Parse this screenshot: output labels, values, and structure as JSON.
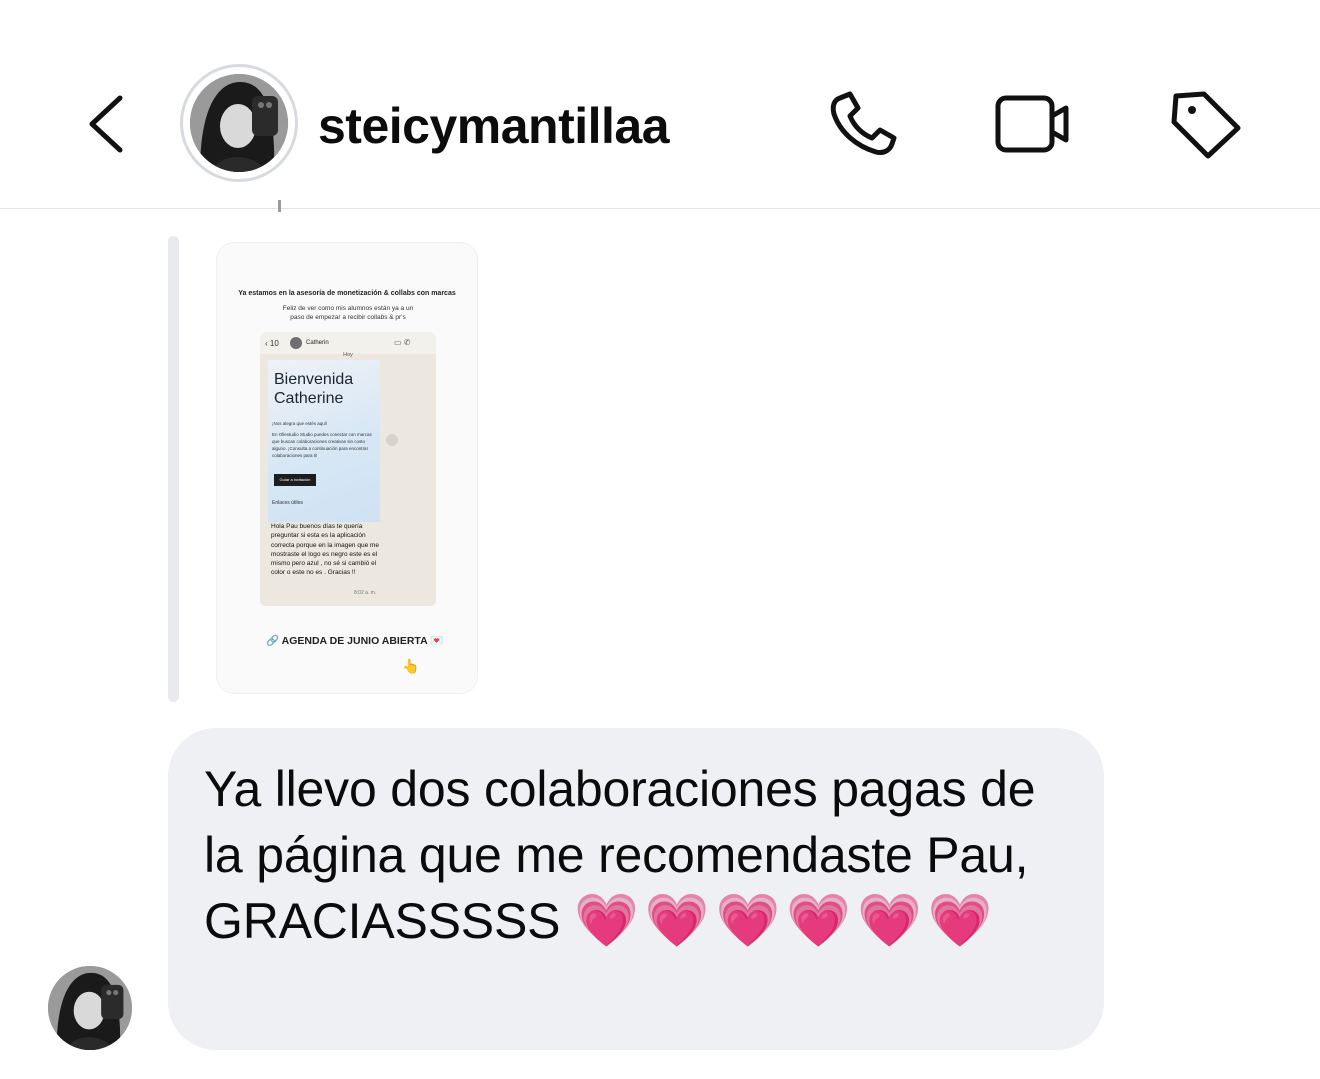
{
  "header": {
    "username": "steicymantillaa",
    "back_icon": "chevron-left-icon",
    "call_icon": "phone-icon",
    "video_icon": "video-camera-icon",
    "tag_icon": "tag-icon"
  },
  "reply": {
    "story": {
      "title": "Ya estamos en la asesoría de monetización & collabs con marcas",
      "subtitle": "Feliz de ver como mis alumnos están ya a un paso de empezar a recibir collabs & pr's",
      "phone": {
        "back_count": "10",
        "contact": "Catherin",
        "day_label": "Hoy",
        "card_heading_1": "Bienvenida",
        "card_heading_2": "Catherine",
        "card_line": "¡Nos alegra que estés aquí!",
        "card_body": "En Ollestudio Studio puedes conectar con marcas que buscan colaboraciones creativas sin costo alguno. ¡Consulta a continuación para encontrar colaboraciones para ti!",
        "card_button": "Guiar a invitación",
        "card_links": "Enlaces útiles",
        "message": "Hola Pau buenos días te quería preguntar si esta es la aplicación correcta porque en la imagen que me mostraste el logo es negro este es el mismo pero azul , no sé si cambió el color o este no es . Gracias !!",
        "time": "8:02 a. m."
      },
      "link_text": "AGENDA DE JUNIO ABIERTA"
    }
  },
  "message": {
    "text": "Ya llevo dos colaboraciones pagas de la página que me recomendaste Pau, GRACIASSSSS",
    "hearts": "💗💗💗💗💗💗"
  },
  "colors": {
    "bubble": "#eff0f3",
    "heart": "#e0199a",
    "divider": "#e4e4e6"
  }
}
